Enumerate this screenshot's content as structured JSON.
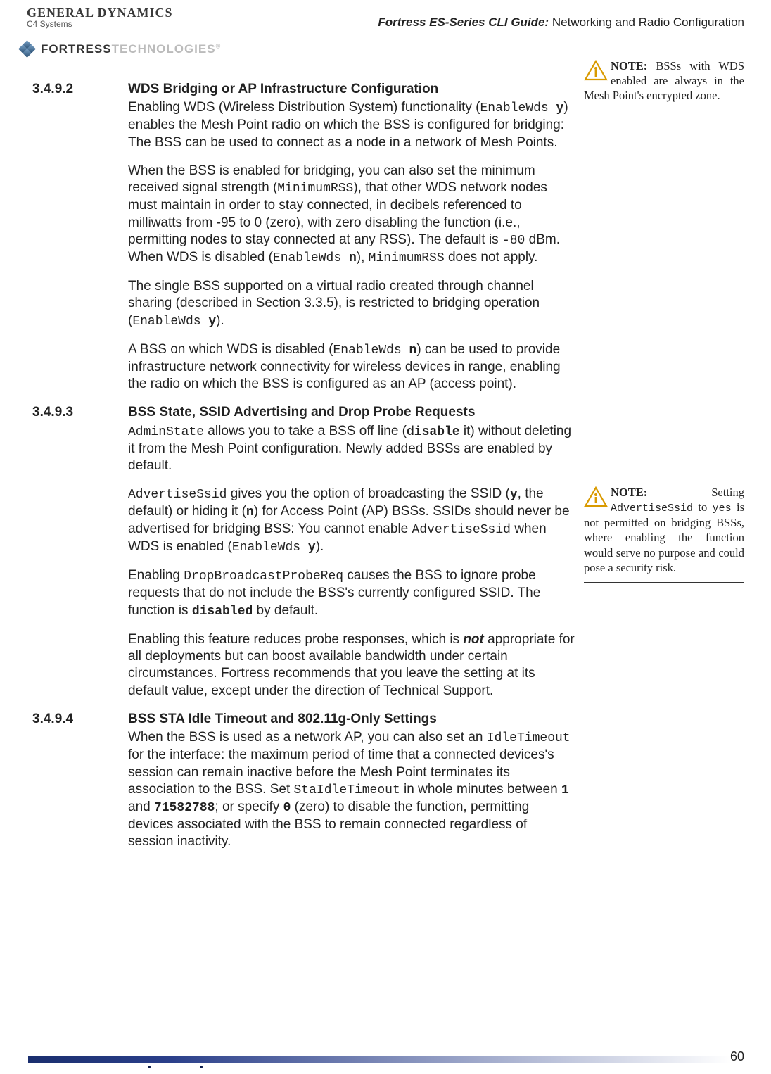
{
  "header": {
    "brand_line1": "GENERAL DYNAMICS",
    "brand_line2": "C4 Systems",
    "title_bold": "Fortress ES-Series CLI Guide:",
    "title_rest": " Networking and Radio Configuration",
    "fortress": "FORTRESS",
    "tech": "TECHNOLOGIES",
    "reg": "®"
  },
  "sections": [
    {
      "num": "3.4.9.2",
      "heading": "WDS Bridging or AP Infrastructure Configuration",
      "paragraphs": [
        {
          "pre": "Enabling WDS (Wireless Distribution System) functionality (",
          "mono": "EnableWds ",
          "monob": "y",
          "post": ") enables the Mesh Point radio on which the BSS is configured for bridging: The BSS can be used to connect as a node in a network of Mesh Points."
        },
        {
          "pre": " When the BSS is enabled for bridging, you can also set the minimum received signal strength (",
          "mono": "MinimumRSS",
          "post1": "), that other WDS network nodes must maintain in order to stay connected, in decibels referenced to milliwatts from -95 to 0 (zero), with zero disabling the function (i.e., permitting nodes to stay connected at any RSS). The default is ",
          "mono2": "-80",
          "post2": " dBm. When WDS is disabled (",
          "mono3": "EnableWds ",
          "monob3": "n",
          "post3": "), ",
          "mono4": "MinimumRSS",
          "post4": " does not apply."
        },
        {
          "pre": "The single BSS supported on a virtual radio created through channel sharing (described in Section 3.3.5), is restricted to bridging operation (",
          "mono": "EnableWds ",
          "monob": "y",
          "post": ")."
        },
        {
          "pre": "A BSS on which WDS is disabled (",
          "mono": "EnableWds ",
          "monob": "n",
          "post": ") can be used to provide infrastructure network connectivity for wireless devices in range, enabling the radio on which the BSS is configured as an AP (access point)."
        }
      ]
    },
    {
      "num": "3.4.9.3",
      "heading": "BSS State, SSID Advertising and Drop Probe Requests",
      "paragraphs": [
        {
          "mono0": "AdminState",
          "pre": " allows you to take a BSS off line (",
          "monob": "disable",
          "post": " it) without deleting it from the Mesh Point configuration. Newly added BSSs are enabled by default."
        },
        {
          "mono0": "AdvertiseSsid",
          "pre": " gives you the option of broadcasting the SSID (",
          "monob": "y",
          "mid1": ", the default) or hiding it (",
          "monob2": "n",
          "mid2": ") for Access Point (AP) BSSs. SSIDs should never be advertised for bridging BSS: You cannot enable ",
          "mono3": "AdvertiseSsid",
          "mid3": " when WDS is enabled (",
          "mono4": "EnableWds ",
          "monob4": "y",
          "post": ")."
        },
        {
          "pre": "Enabling ",
          "mono": "DropBroadcastProbeReq",
          "mid": " causes the BSS to ignore probe requests that do not include the BSS's currently configured SSID. The function is ",
          "monob": "disabled",
          "post": " by default."
        },
        {
          "pre": "Enabling this feature reduces probe responses, which is ",
          "emnot": "not",
          "post": " appropriate for all deployments but can boost available bandwidth under certain circumstances. Fortress recommends that you leave the setting at its default value, except under the direction of Technical Support."
        }
      ]
    },
    {
      "num": "3.4.9.4",
      "heading": "BSS STA Idle Timeout and 802.11g-Only Settings",
      "paragraphs": [
        {
          "pre": "When the BSS is used as a network AP, you can also set an ",
          "mono": "IdleTimeout",
          "mid": " for the interface: the maximum period of time that a connected devices's session can remain inactive before the Mesh Point terminates its association to the BSS. Set ",
          "mono2": "StaIdleTimeout",
          "mid2": " in whole minutes between ",
          "monob2": "1",
          "mid3": " and ",
          "monob3": "71582788",
          "mid4": "; or specify ",
          "monob4": "0",
          "post": " (zero) to disable the function, permitting devices associated with the BSS to remain connected regardless of session inactivity."
        }
      ]
    }
  ],
  "sidenotes": {
    "note1": {
      "label": "NOTE:",
      "text_before": " BSSs with WDS enabled are always in the Mesh Point's encrypted zone."
    },
    "note2": {
      "label": "NOTE:",
      "w_setting": "Setting",
      "mono": "AdvertiseSsid",
      "to": " to ",
      "yes": "yes",
      "rest": " is not permitted on bridging BSSs, where enabling the function would serve no purpose and could pose a security risk."
    }
  },
  "footer": {
    "page": "60"
  }
}
